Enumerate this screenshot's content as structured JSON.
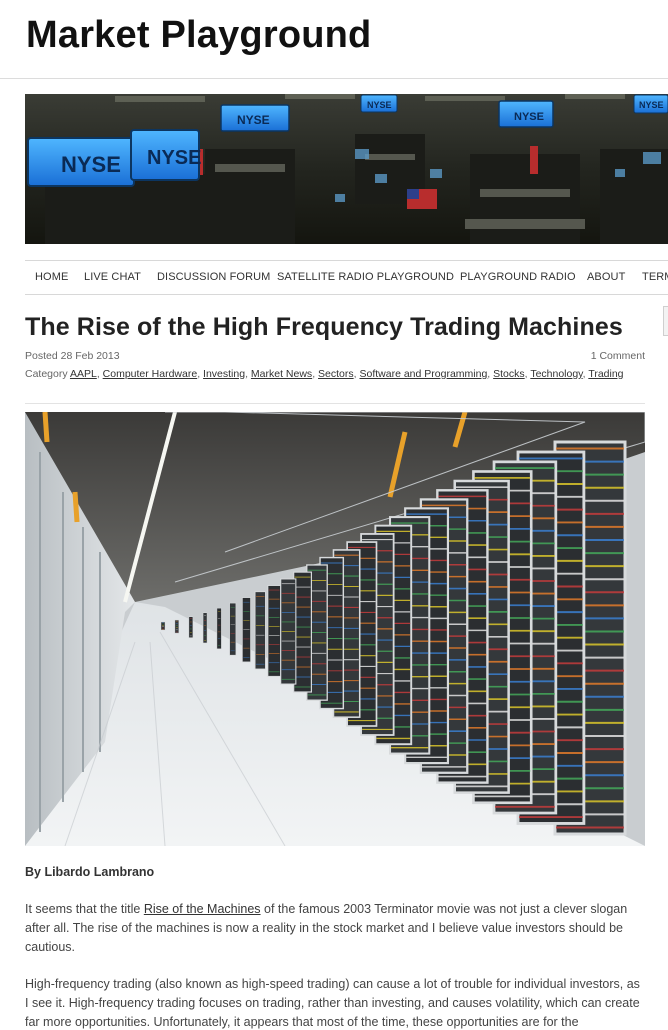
{
  "site": {
    "title": "Market Playground"
  },
  "banner": {
    "signs": [
      "NYSE",
      "NYSE",
      "NYSE",
      "NYSE",
      "NYSE",
      "NYSE"
    ]
  },
  "nav": {
    "items": [
      "HOME",
      "LIVE CHAT",
      "DISCUSSION FORUM",
      "SATELLITE RADIO PLAYGROUND",
      "PLAYGROUND RADIO",
      "ABOUT",
      "TERMS"
    ]
  },
  "post": {
    "title": "The Rise of the High Frequency Trading Machines",
    "posted": "Posted 28 Feb 2013",
    "comments": "1 Comment",
    "category_label": "Category",
    "categories": [
      "AAPL",
      "Computer Hardware",
      "Investing",
      "Market News",
      "Sectors",
      "Software and Programming",
      "Stocks",
      "Technology",
      "Trading"
    ],
    "byline": "By Libardo Lambrano",
    "p1_before": "It seems that the title ",
    "p1_link": "Rise of the Machines",
    "p1_after": " of the famous 2003 Terminator movie was not just a clever slogan after all. The rise of the machines is now a reality in the stock market and I believe value investors should be cautious.",
    "p2": "High-frequency trading (also known as high-speed trading) can cause a lot of trouble for individual investors, as I see it. High-frequency trading focuses on trading, rather than investing, and causes volatility, which can create far more opportunities. Unfortunately, it appears that most of the time, these opportunities are for the"
  }
}
